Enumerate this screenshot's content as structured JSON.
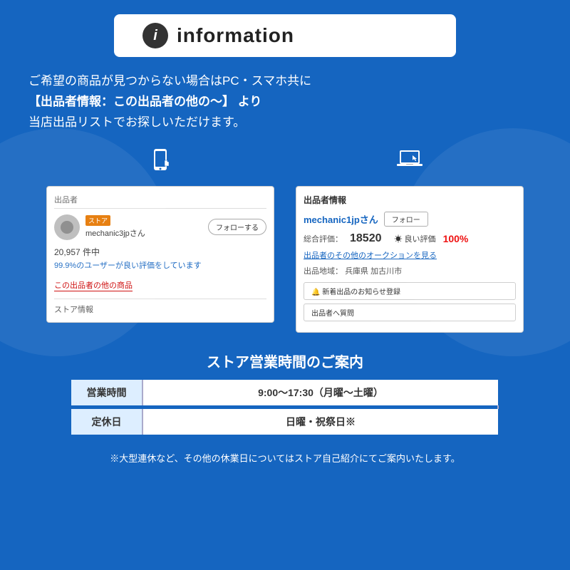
{
  "header": {
    "icon_char": "i",
    "title": "information"
  },
  "description": {
    "line1": "ご希望の商品が見つからない場合はPC・スマホ共に",
    "line2": "【出品者情報：この出品者の他の〜】 より",
    "line3": "当店出品リストでお探しいただけます。"
  },
  "mobile_screenshot": {
    "label": "出品者",
    "store_badge": "ストア",
    "seller_name": "mechanic3jpさん",
    "follow_btn": "フォローする",
    "count": "20,957 件中",
    "rating_text": "99.9%のユーザーが良い評価をしています",
    "other_link": "この出品者の他の商品",
    "store_link": "ストア情報"
  },
  "pc_screenshot": {
    "title": "出品者情報",
    "seller_name": "mechanic1jpさん",
    "follow_btn": "フォロー",
    "rating_label": "総合評価：",
    "rating_num": "18520",
    "good_label": "☀ 良い評価",
    "good_pct": "100%",
    "auction_link": "出品者のその他のオークションを見る",
    "location_label": "出品地域：",
    "location": "兵庫県 加古川市",
    "new_items_btn": "🔔 新着出品のお知らせ登録",
    "question_btn": "出品者へ質問"
  },
  "hours_section": {
    "title": "ストア営業時間のご案内",
    "rows": [
      {
        "label": "営業時間",
        "value": "9:00〜17:30（月曜〜土曜）"
      },
      {
        "label": "定休日",
        "value": "日曜・祝祭日※"
      }
    ]
  },
  "footer_note": "※大型連休など、その他の休業日についてはストア自己紹介にてご案内いたします。"
}
